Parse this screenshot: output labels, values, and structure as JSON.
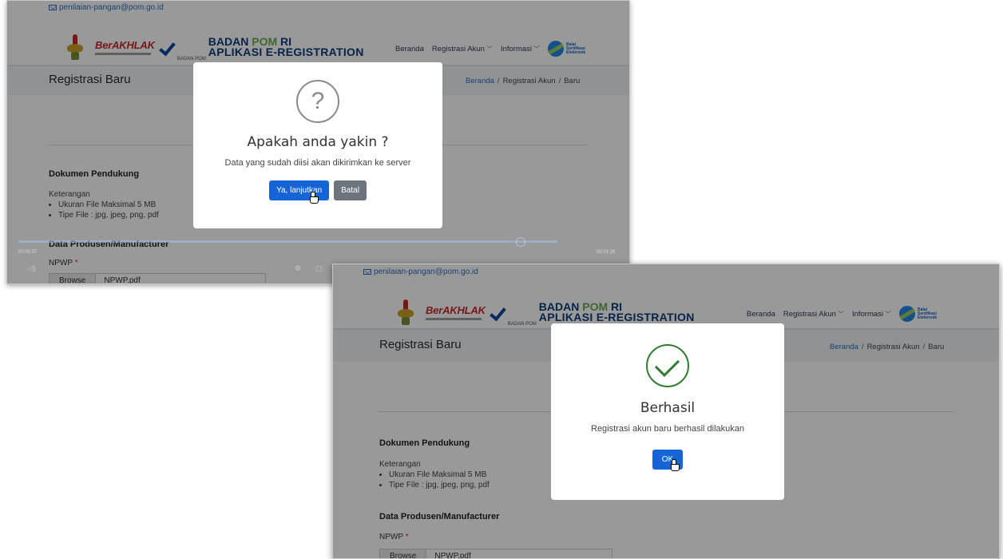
{
  "email": "penilaian-pangan@pom.go.id",
  "logo": {
    "berakhlak": "BerAKHLAK",
    "badan_small": "BADAN POM",
    "brand_line1_a": "BADAN ",
    "brand_line1_b": "POM",
    "brand_line1_c": " RI",
    "brand_line2": "APLIKASI E-REGISTRATION"
  },
  "nav": {
    "beranda": "Beranda",
    "registrasi_akun": "Registrasi Akun",
    "informasi": "Informasi",
    "chevron": "﹀",
    "bse": "Balai Sertifikasi Elektronik"
  },
  "page": {
    "title": "Registrasi Baru"
  },
  "breadcrumb": {
    "home": "Beranda",
    "sep": "/",
    "mid": "Registrasi Akun",
    "current": "Baru"
  },
  "form": {
    "dokumen_title": "Dokumen Pendukung",
    "keterangan": "Keterangan",
    "bullets": [
      "Ukuran File Maksimal 5 MB",
      "Tipe File : jpg, jpeg, png, pdf"
    ],
    "produsen_title": "Data Produsen/Manufacturer",
    "npwp_label": "NPWP",
    "required_mark": "*",
    "browse": "Browse",
    "filename": "NPWP.pdf"
  },
  "video": {
    "time_left": "00:00:37",
    "time_right": "00:01:26",
    "progress": 0.93
  },
  "confirm_dialog": {
    "icon": "question-icon",
    "title": "Apakah anda yakin ?",
    "text": "Data yang sudah diisi akan dikirimkan ke server",
    "confirm": "Ya, lanjutkan",
    "cancel": "Batal"
  },
  "success_dialog": {
    "icon": "check-circle-icon",
    "title": "Berhasil",
    "text": "Registrasi akun baru berhasil dilakukan",
    "ok": "OK"
  },
  "colors": {
    "primary": "#1565d8",
    "secondary": "#6c757d",
    "success": "#2e7d32",
    "brand": "#0d3b7a"
  }
}
